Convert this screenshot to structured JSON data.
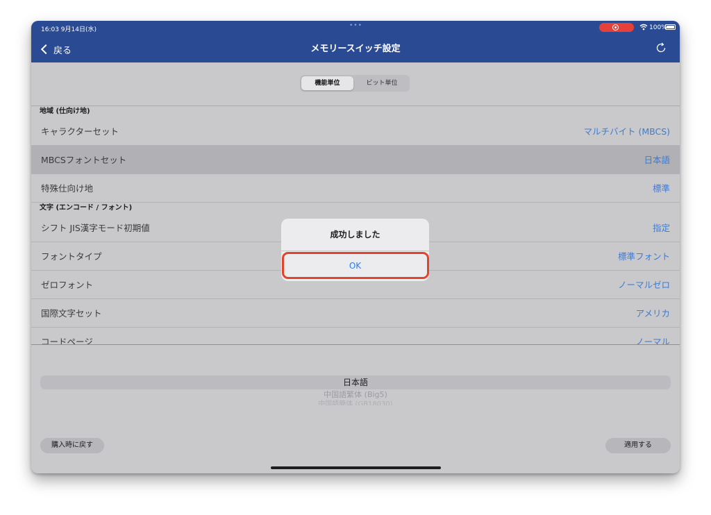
{
  "status_bar": {
    "time": "16:03  9月14日(水)",
    "dots": "•••",
    "battery": "100%",
    "icons": [
      "screen-record-icon",
      "wifi-icon",
      "battery-icon"
    ]
  },
  "nav": {
    "back_label": "戻る",
    "title": "メモリースイッチ設定",
    "refresh_icon": "refresh-icon"
  },
  "segmented": {
    "options": [
      "機能単位",
      "ビット単位"
    ],
    "selected": "機能単位"
  },
  "sections": [
    {
      "header": "地域 (仕向け地)",
      "rows": [
        {
          "label": "キャラクターセット",
          "value": "マルチバイト (MBCS)"
        },
        {
          "label": "MBCSフォントセット",
          "value": "日本語",
          "selected": true
        },
        {
          "label": "特殊仕向け地",
          "value": "標準"
        }
      ]
    },
    {
      "header": "文字 (エンコード / フォント)",
      "rows": [
        {
          "label": "シフト JIS漢字モード初期値",
          "value": "指定"
        },
        {
          "label": "フォントタイプ",
          "value": "標準フォント"
        },
        {
          "label": "ゼロフォント",
          "value": "ノーマルゼロ"
        },
        {
          "label": "国際文字セット",
          "value": "アメリカ"
        },
        {
          "label": "コードページ",
          "value": "ノーマル"
        }
      ]
    }
  ],
  "picker": {
    "selected": "日本語",
    "options": [
      "中国語繁体 (Big5)",
      "中国語簡体 (GB18030)"
    ]
  },
  "buttons": {
    "reset": "購入時に戻す",
    "apply": "適用する"
  },
  "alert": {
    "title": "成功しました",
    "ok": "OK"
  },
  "colors": {
    "nav_bar": "#2a4b93",
    "accent": "#3d7bd1",
    "highlight": "#e0452c",
    "record": "#e5403a"
  }
}
